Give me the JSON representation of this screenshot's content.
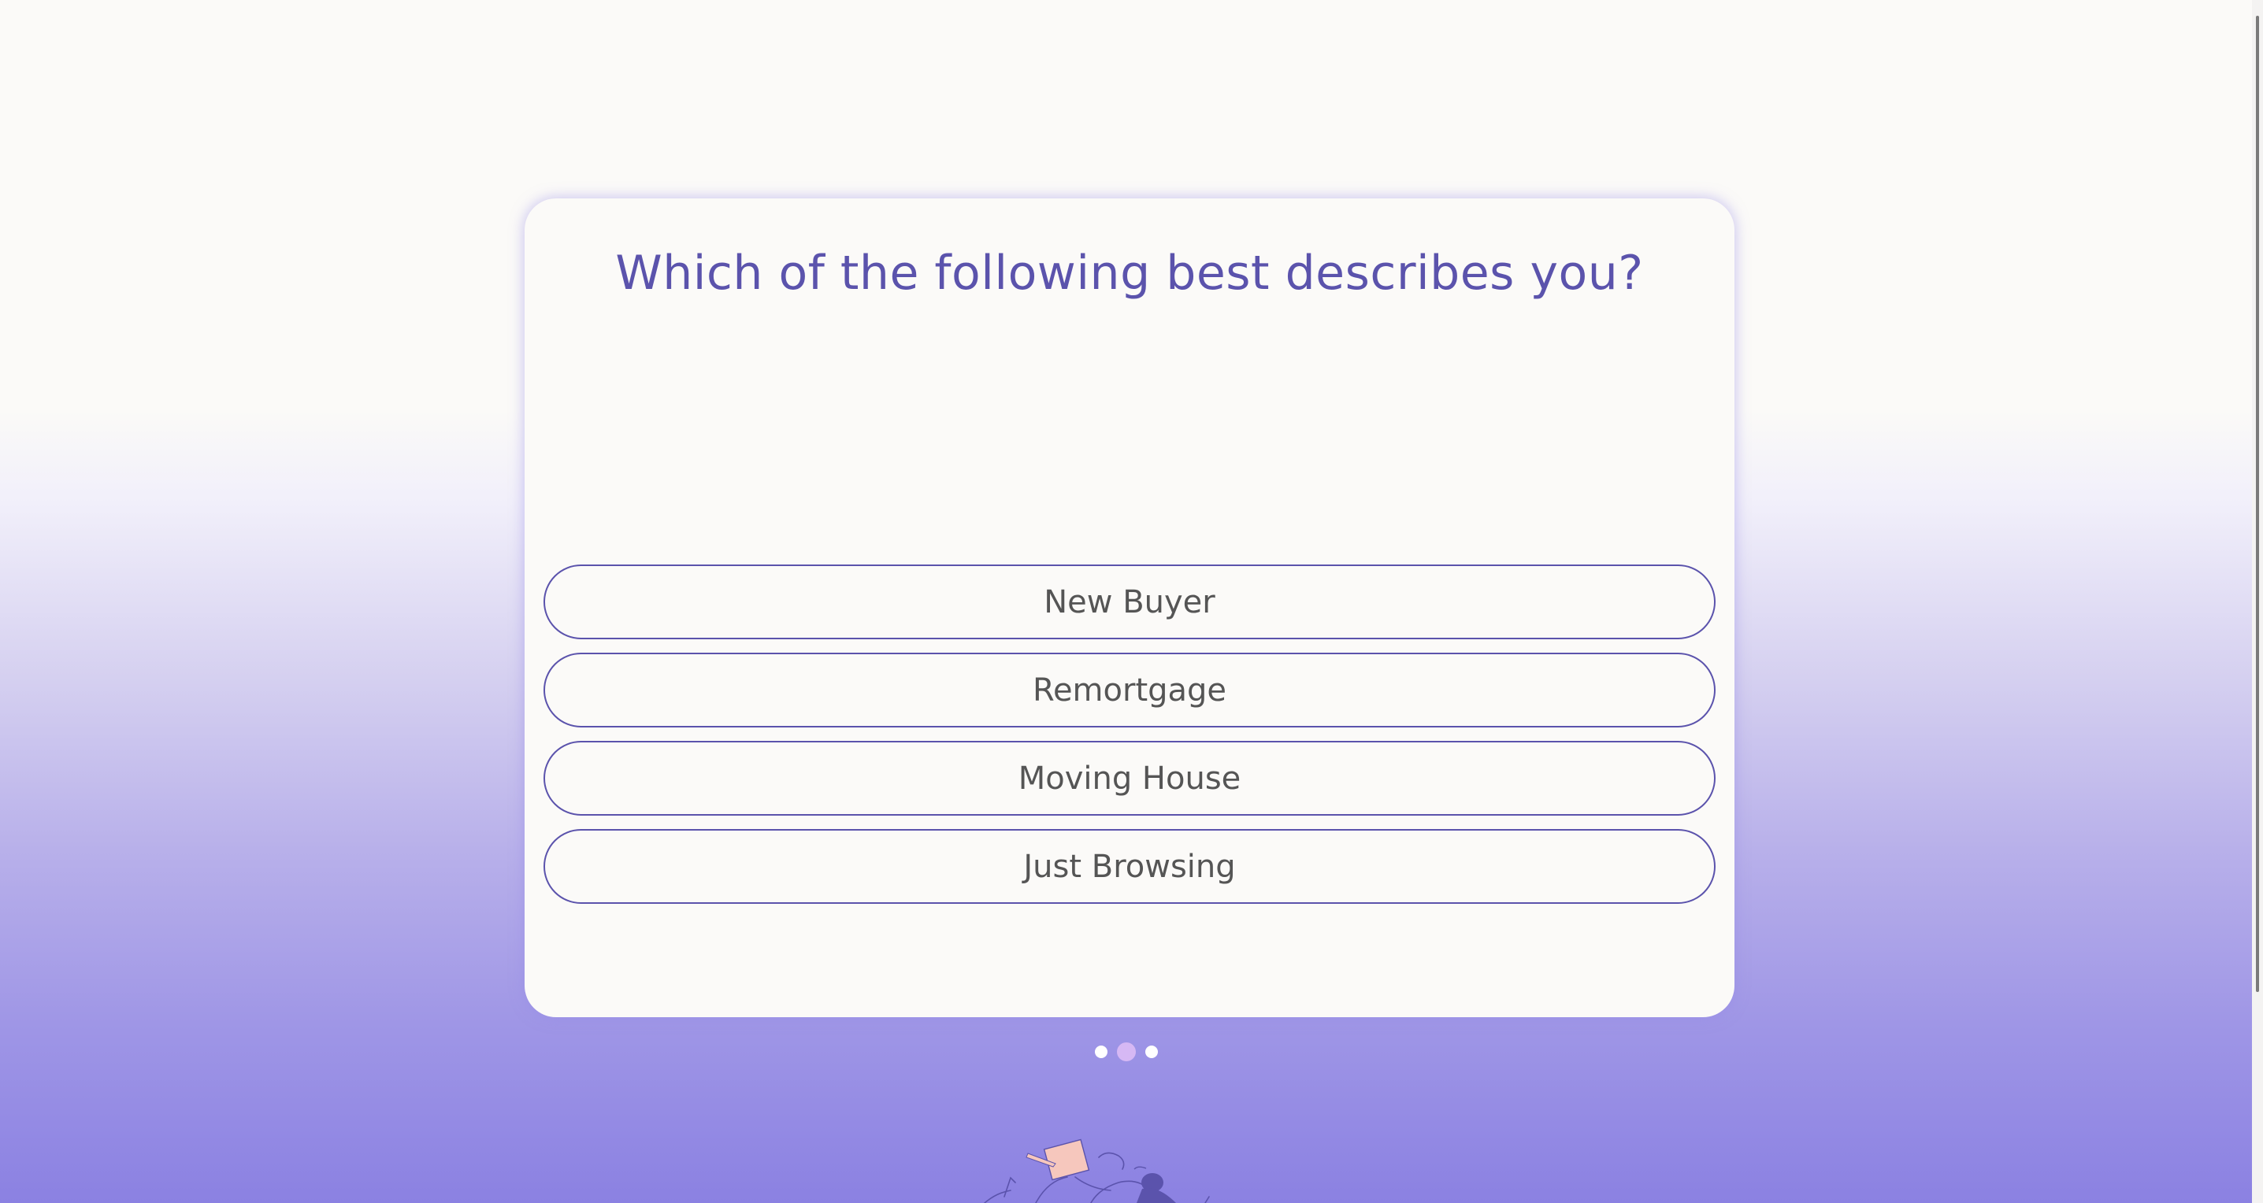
{
  "question": {
    "title": "Which of the following best describes you?"
  },
  "options": [
    {
      "label": "New Buyer"
    },
    {
      "label": "Remortgage"
    },
    {
      "label": "Moving House"
    },
    {
      "label": "Just Browsing"
    }
  ],
  "pagination": {
    "total_steps": 3,
    "current_step": 2
  },
  "colors": {
    "accent": "#5b53ac",
    "option_text": "#555555",
    "card_background": "#fbfaf8",
    "active_dot": "#d6b8f4",
    "gradient_bottom": "#8b81e2"
  },
  "icons": {
    "illustration": "person-reading-illustration"
  }
}
